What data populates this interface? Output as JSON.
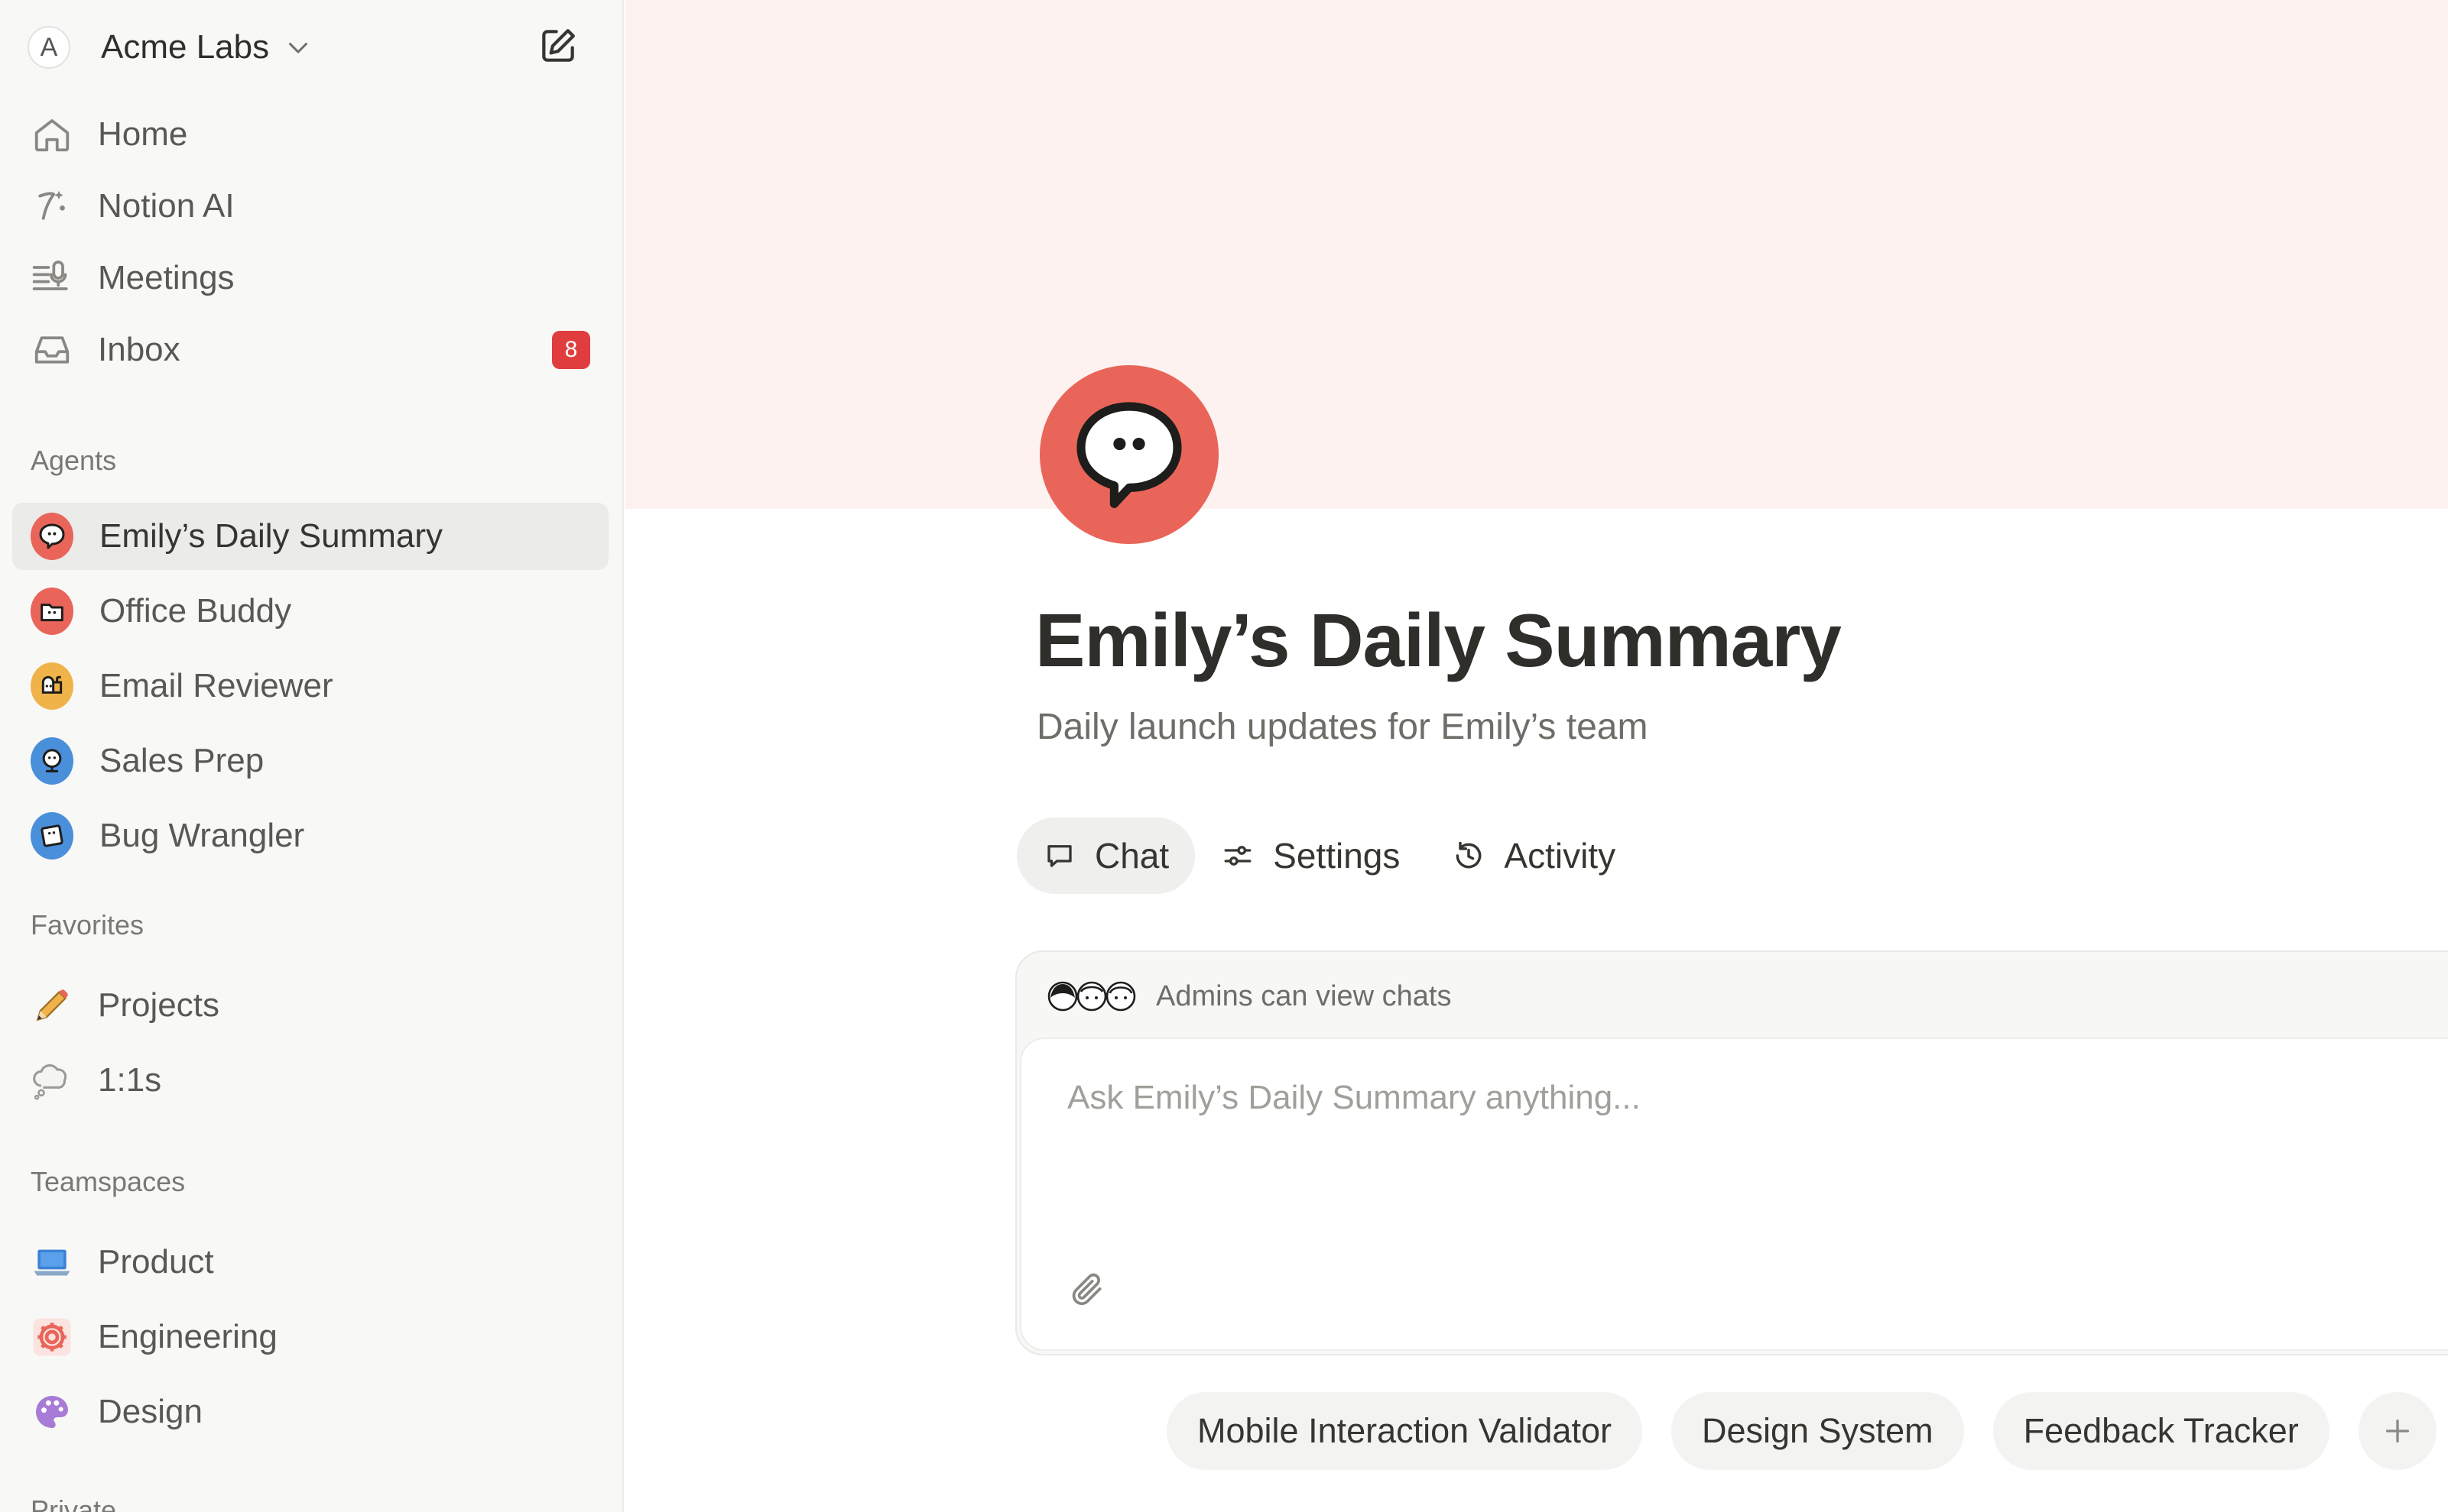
{
  "workspace": {
    "initial": "A",
    "name": "Acme Labs"
  },
  "nav": [
    {
      "label": "Home",
      "icon": "home-icon"
    },
    {
      "label": "Notion AI",
      "icon": "notion-ai-icon"
    },
    {
      "label": "Meetings",
      "icon": "meetings-icon"
    },
    {
      "label": "Inbox",
      "icon": "inbox-icon",
      "badge": "8"
    }
  ],
  "sections": {
    "agents": "Agents",
    "favorites": "Favorites",
    "teamspaces": "Teamspaces",
    "private": "Private"
  },
  "agents": [
    {
      "label": "Emily’s Daily Summary",
      "color": "#e9655a",
      "selected": true
    },
    {
      "label": "Office Buddy",
      "color": "#e9655a"
    },
    {
      "label": "Email Reviewer",
      "color": "#f0b34a"
    },
    {
      "label": "Sales Prep",
      "color": "#4a8fd9"
    },
    {
      "label": "Bug Wrangler",
      "color": "#4a8fd9"
    }
  ],
  "favorites": [
    {
      "label": "Projects",
      "icon": "pencil-icon"
    },
    {
      "label": "1:1s",
      "icon": "thought-bubble-icon"
    }
  ],
  "teamspaces": [
    {
      "label": "Product",
      "icon": "laptop-icon",
      "color": "#3b82d6"
    },
    {
      "label": "Engineering",
      "icon": "gear-icon",
      "color": "#e9655a"
    },
    {
      "label": "Design",
      "icon": "palette-icon",
      "color": "#a77bd6"
    }
  ],
  "page": {
    "title": "Emily’s Daily Summary",
    "description": "Daily launch updates for Emily’s team",
    "cover_color": "#fdf2f0",
    "icon_color": "#e9655a"
  },
  "tabs": [
    {
      "label": "Chat",
      "active": true
    },
    {
      "label": "Settings"
    },
    {
      "label": "Activity"
    }
  ],
  "chat": {
    "visibility_note": "Admins can view chats",
    "placeholder": "Ask Emily’s Daily Summary anything..."
  },
  "suggestions": [
    "Mobile Interaction Validator",
    "Design System",
    "Feedback Tracker"
  ]
}
